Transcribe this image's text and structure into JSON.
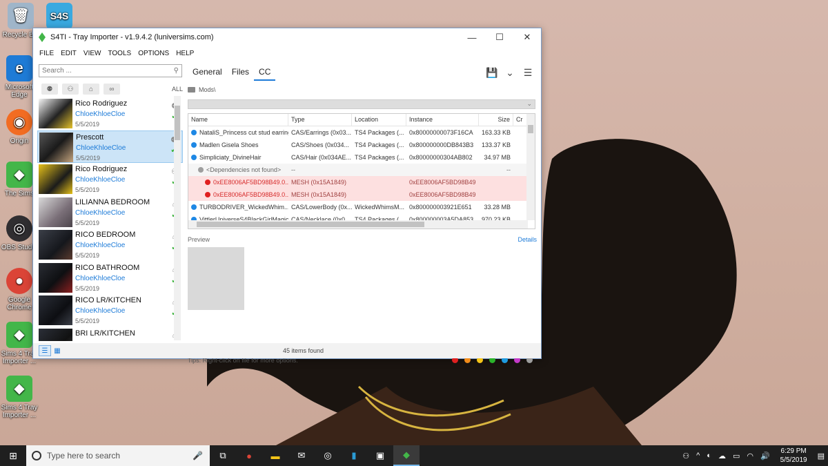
{
  "desktop": {
    "icons": [
      {
        "label": "Recycle Bin",
        "icon": "recycle-bin-icon"
      },
      {
        "label": "S4S",
        "icon": "s4s-icon"
      },
      {
        "label": "Microsoft Edge",
        "icon": "edge-icon"
      },
      {
        "label": "Origin",
        "icon": "origin-icon"
      },
      {
        "label": "The Sims",
        "icon": "sims-icon"
      },
      {
        "label": "OBS Studio",
        "icon": "obs-icon"
      },
      {
        "label": "Google Chrome",
        "icon": "chrome-icon"
      },
      {
        "label": "Sims 4 Tray Importer ...",
        "icon": "sims4-tray-importer-icon"
      },
      {
        "label": "Sims 4 Tray Importer ...",
        "icon": "sims4-tray-importer-icon"
      }
    ]
  },
  "window": {
    "title": "S4TI - Tray Importer - v1.9.4.2  (luniversims.com)",
    "controls": {
      "minimize": "—",
      "maximize": "☐",
      "close": "✕"
    }
  },
  "menu": [
    "FILE",
    "EDIT",
    "VIEW",
    "TOOLS",
    "OPTIONS",
    "HELP"
  ],
  "sidebar": {
    "search_placeholder": "Search ...",
    "filter_all": "ALL",
    "items": [
      {
        "name": "Rico Rodriguez",
        "creator": "ChloeKhloeCloe",
        "date": "5/5/2019",
        "selected": false
      },
      {
        "name": "Prescott",
        "creator": "ChloeKhloeCloe",
        "date": "5/5/2019",
        "selected": true
      },
      {
        "name": "Rico Rodriguez",
        "creator": "ChloeKhloeCloe",
        "date": "5/5/2019",
        "selected": false
      },
      {
        "name": "LILIANNA BEDROOM",
        "creator": "ChloeKhloeCloe",
        "date": "5/5/2019",
        "selected": false
      },
      {
        "name": "RICO BEDROOM",
        "creator": "ChloeKhloeCloe",
        "date": "5/5/2019",
        "selected": false
      },
      {
        "name": "RICO BATHROOM",
        "creator": "ChloeKhloeCloe",
        "date": "5/5/2019",
        "selected": false
      },
      {
        "name": "RICO LR/KITCHEN",
        "creator": "ChloeKhloeCloe",
        "date": "5/5/2019",
        "selected": false
      },
      {
        "name": "BRI LR/KITCHEN",
        "creator": "",
        "date": "",
        "selected": false
      }
    ]
  },
  "main": {
    "tabs": [
      {
        "label": "General",
        "active": false
      },
      {
        "label": "Files",
        "active": false
      },
      {
        "label": "CC",
        "active": true
      }
    ],
    "path": "Mods\\",
    "columns": {
      "name": "Name",
      "type": "Type",
      "location": "Location",
      "instance": "Instance",
      "size": "Size",
      "creator": "Cr"
    },
    "rows": [
      {
        "name": "NataliS_Princess cut stud earrings",
        "type": "CAS/Earrings (0x03...",
        "location": "TS4 Packages (...",
        "instance": "0x80000000073F16CA",
        "size": "163.33 KB",
        "dot": "#1e88e5",
        "kind": "normal"
      },
      {
        "name": "Madlen Gisela Shoes",
        "type": "CAS/Shoes (0x034...",
        "location": "TS4 Packages (...",
        "instance": "0x800000000DB843B3",
        "size": "133.37 KB",
        "dot": "#1e88e5",
        "kind": "normal"
      },
      {
        "name": "Simpliciaty_DivineHair",
        "type": "CAS/Hair (0x034AE...",
        "location": "TS4 Packages (...",
        "instance": "0x80000000304AB802",
        "size": "34.97 MB",
        "dot": "#1e88e5",
        "kind": "normal"
      },
      {
        "name": "<Dependencies not found>",
        "type": "--",
        "location": "",
        "instance": "",
        "size": "--",
        "dot": "#9e9e9e",
        "kind": "group"
      },
      {
        "name": "0xEE8006AF5BD98B49.0...",
        "type": "MESH (0x15A1849)",
        "location": "",
        "instance": "0xEE8006AF5BD98B49",
        "size": "",
        "dot": "#e02020",
        "kind": "err"
      },
      {
        "name": "0xEE8006AF5BD98B49.0...",
        "type": "MESH (0x15A1849)",
        "location": "",
        "instance": "0xEE8006AF5BD98B49",
        "size": "",
        "dot": "#e02020",
        "kind": "err"
      },
      {
        "name": "TURBODRIVER_WickedWhim...",
        "type": "CAS/LowerBody (0x...",
        "location": "WickedWhimsM...",
        "instance": "0x800000003921E651",
        "size": "33.28 MB",
        "dot": "#1e88e5",
        "kind": "normal"
      },
      {
        "name": "VittlerUniverseS4BlackGirlMagic...",
        "type": "CAS/Necklace (0x0...",
        "location": "TS4 Packages (...",
        "instance": "0x800000003A5DA853",
        "size": "970.23 KB",
        "dot": "#1e88e5",
        "kind": "normal"
      }
    ],
    "preview_label": "Preview",
    "details_label": "Details",
    "tips": "Tips:  Right-click on file for more options.",
    "color_filters": [
      "#e02020",
      "#f28c1a",
      "#f5c518",
      "#2bb32b",
      "#1e9be0",
      "#c53ac9",
      "#9e9e9e"
    ]
  },
  "status": {
    "count": "45 items found"
  },
  "taskbar": {
    "search_placeholder": "Type here to search",
    "time": "6:29 PM",
    "date": "5/5/2019"
  }
}
